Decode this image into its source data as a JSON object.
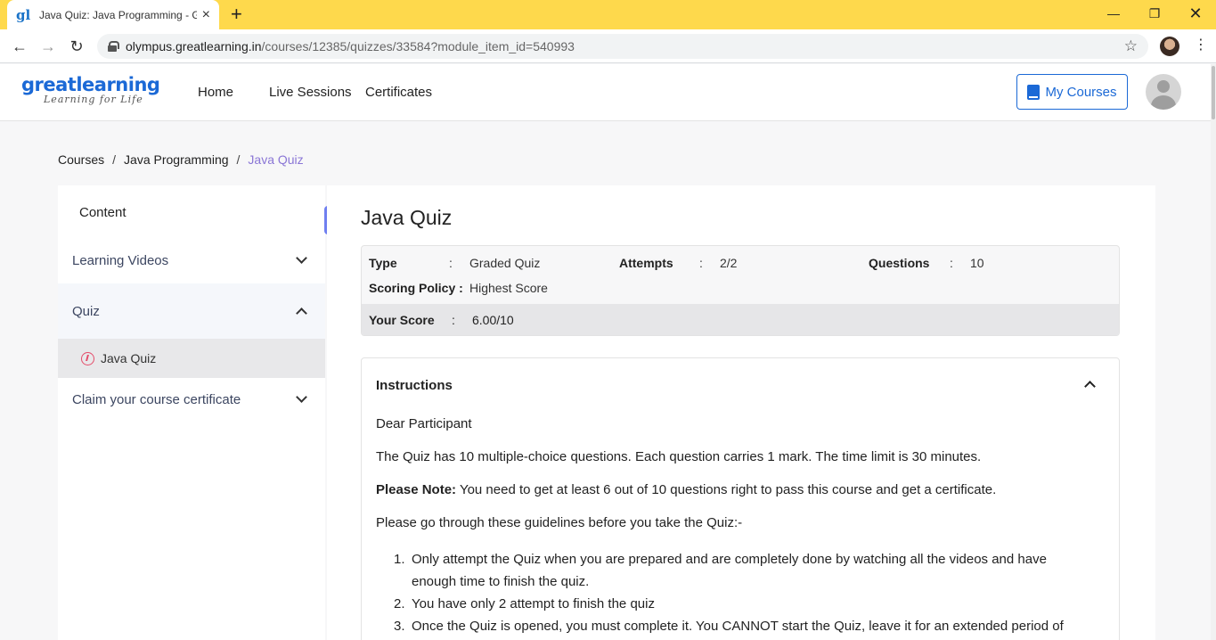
{
  "browser": {
    "tab_title": "Java Quiz: Java Programming - Gr",
    "tab_favicon": "gl",
    "url_host": "olympus.greatlearning.in",
    "url_path": "/courses/12385/quizzes/33584?module_item_id=540993"
  },
  "header": {
    "logo_main": "greatlearning",
    "logo_sub": "Learning for Life",
    "nav": [
      "Home",
      "Live Sessions",
      "Certificates"
    ],
    "my_courses_label": "My Courses"
  },
  "breadcrumb": {
    "items": [
      "Courses",
      "Java Programming",
      "Java Quiz"
    ],
    "separator": "/"
  },
  "sidebar": {
    "title": "Content",
    "items": [
      {
        "label": "Learning Videos",
        "expanded": false
      },
      {
        "label": "Quiz",
        "expanded": true
      },
      {
        "label": "Claim your course certificate",
        "expanded": false
      }
    ],
    "sub_item": "Java Quiz",
    "collapse_glyph": "«"
  },
  "quiz": {
    "title": "Java Quiz",
    "type_label": "Type",
    "type_value": "Graded Quiz",
    "attempts_label": "Attempts",
    "attempts_value": "2/2",
    "questions_label": "Questions",
    "questions_value": "10",
    "scoring_label": "Scoring Policy :",
    "scoring_value": "Highest Score",
    "score_label": "Your Score",
    "score_value": "6.00/10",
    "colon": ":"
  },
  "instructions": {
    "heading": "Instructions",
    "greeting": "Dear Participant",
    "p1": "The Quiz has 10 multiple-choice questions. Each question carries 1 mark. The time limit is 30 minutes.",
    "note_label": "Please Note:",
    "note_text": " You need to get at least 6 out of 10 questions right to pass this course and get a certificate.",
    "guidelines": "Please go through these guidelines before you take the Quiz:-",
    "list": [
      {
        "num": "1.",
        "text": "Only attempt the Quiz when you are prepared and are completely done by watching all the videos and have enough time to finish the quiz."
      },
      {
        "num": "2.",
        "text": "You have only 2 attempt to finish the quiz"
      },
      {
        "num": "3.",
        "text": "Once the Quiz is opened, you must complete it. You CANNOT start the Quiz, leave it for an extended period of"
      }
    ]
  },
  "colors": {
    "tabbar": "#fed94c",
    "brand_blue": "#1b69d6",
    "breadcrumb_active": "#8a76d6",
    "collapse_button": "#6f7ff0",
    "quiz_icon": "#e44c6a"
  }
}
